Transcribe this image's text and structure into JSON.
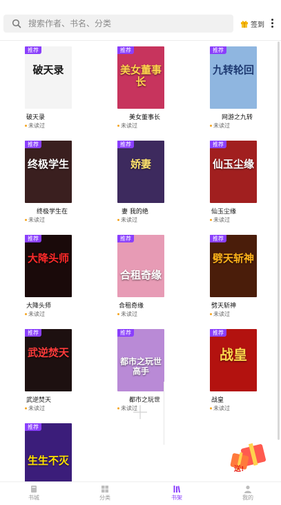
{
  "search": {
    "placeholder": "搜索作者、书名、分类"
  },
  "header": {
    "signin_label": "签到"
  },
  "badge_label": "推荐",
  "books": [
    {
      "title": "破天录",
      "status": "未读过",
      "cover_text": "破天录",
      "cover_bg": "#f4f4f4",
      "cover_fg": "#1a1a1a"
    },
    {
      "title": "美女董事长",
      "status": "未读过",
      "cover_text": "美女董事长",
      "cover_bg": "#c7345d",
      "cover_fg": "#ffd34d"
    },
    {
      "title": "网游之九转",
      "status": "未读过",
      "cover_text": "九转轮回",
      "cover_bg": "#8fb6e0",
      "cover_fg": "#1f3b73"
    },
    {
      "title": "终极学生在",
      "status": "未读过",
      "cover_text": "终极学生",
      "cover_bg": "#3a1f1f",
      "cover_fg": "#ffffff"
    },
    {
      "title": "妻   我的绝",
      "status": "未读过",
      "cover_text": "娇妻",
      "cover_bg": "#3d2a5e",
      "cover_fg": "#ffe36e"
    },
    {
      "title": "仙玉尘缘",
      "status": "未读过",
      "cover_text": "仙玉尘缘",
      "cover_bg": "#a11f1f",
      "cover_fg": "#ffffff"
    },
    {
      "title": "大降头师",
      "status": "未读过",
      "cover_text": "大降头师",
      "cover_bg": "#1a0a0a",
      "cover_fg": "#ff2a2a"
    },
    {
      "title": "合租奇缘",
      "status": "未读过",
      "cover_text": "合租奇缘",
      "cover_bg": "#e79bb5",
      "cover_fg": "#ffffff"
    },
    {
      "title": "劈天斩神",
      "status": "未读过",
      "cover_text": "劈天斩神",
      "cover_bg": "#4a1d0a",
      "cover_fg": "#ffb31a"
    },
    {
      "title": "武逆焚天",
      "status": "未读过",
      "cover_text": "武逆焚天",
      "cover_bg": "#1d1010",
      "cover_fg": "#ff3b3b"
    },
    {
      "title": "都市之玩世",
      "status": "未读过",
      "cover_text": "都市之玩世高手",
      "cover_bg": "#b98ad6",
      "cover_fg": "#ffffff"
    },
    {
      "title": "战皇",
      "status": "未读过",
      "cover_text": "战皇",
      "cover_bg": "#b3120f",
      "cover_fg": "#ffd84d"
    },
    {
      "title": "生生不灭",
      "status": "",
      "cover_text": "生生不灭",
      "cover_bg": "#3b1d7a",
      "cover_fg": "#ffe100"
    }
  ],
  "tabs": [
    {
      "label": "书城",
      "active": false
    },
    {
      "label": "分类",
      "active": false
    },
    {
      "label": "书架",
      "active": true
    },
    {
      "label": "我的",
      "active": false
    }
  ],
  "colors": {
    "accent": "#8a3ffc",
    "unread_dot": "#f5a623"
  }
}
